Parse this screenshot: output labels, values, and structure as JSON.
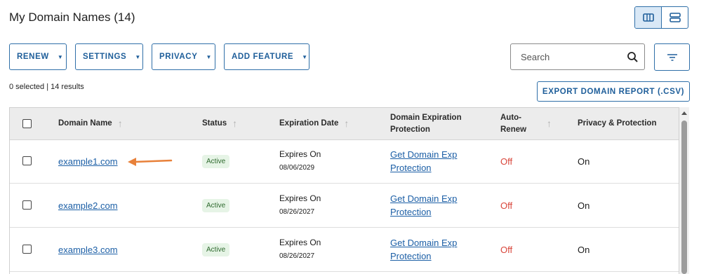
{
  "header": {
    "title": "My Domain Names (14)"
  },
  "toolbar": {
    "renew_label": "RENEW",
    "settings_label": "SETTINGS",
    "privacy_label": "PRIVACY",
    "add_feature_label": "ADD FEATURE",
    "search_placeholder": "Search",
    "selection_summary": "0 selected | 14 results",
    "export_label": "EXPORT DOMAIN REPORT (.CSV)"
  },
  "table": {
    "columns": {
      "domain": "Domain Name",
      "status": "Status",
      "expiration": "Expiration Date",
      "protection_line1": "Domain Expiration",
      "protection_line2": "Protection",
      "autorenew_line1": "Auto-",
      "autorenew_line2": "Renew",
      "privacy": "Privacy & Protection"
    },
    "rows": [
      {
        "domain": "example1.com",
        "status": "Active",
        "expires_label": "Expires On",
        "expires_date": "08/06/2029",
        "protection_line1": "Get Domain Exp",
        "protection_line2": "Protection",
        "auto_renew": "Off",
        "privacy": "On"
      },
      {
        "domain": "example2.com",
        "status": "Active",
        "expires_label": "Expires On",
        "expires_date": "08/26/2027",
        "protection_line1": "Get Domain Exp",
        "protection_line2": "Protection",
        "auto_renew": "Off",
        "privacy": "On"
      },
      {
        "domain": "example3.com",
        "status": "Active",
        "expires_label": "Expires On",
        "expires_date": "08/26/2027",
        "protection_line1": "Get Domain Exp",
        "protection_line2": "Protection",
        "auto_renew": "Off",
        "privacy": "On"
      }
    ]
  },
  "colors": {
    "accent": "#2f6fa8",
    "link": "#1c5fa6",
    "off": "#d9463b",
    "annotation_arrow": "#e8813a"
  }
}
